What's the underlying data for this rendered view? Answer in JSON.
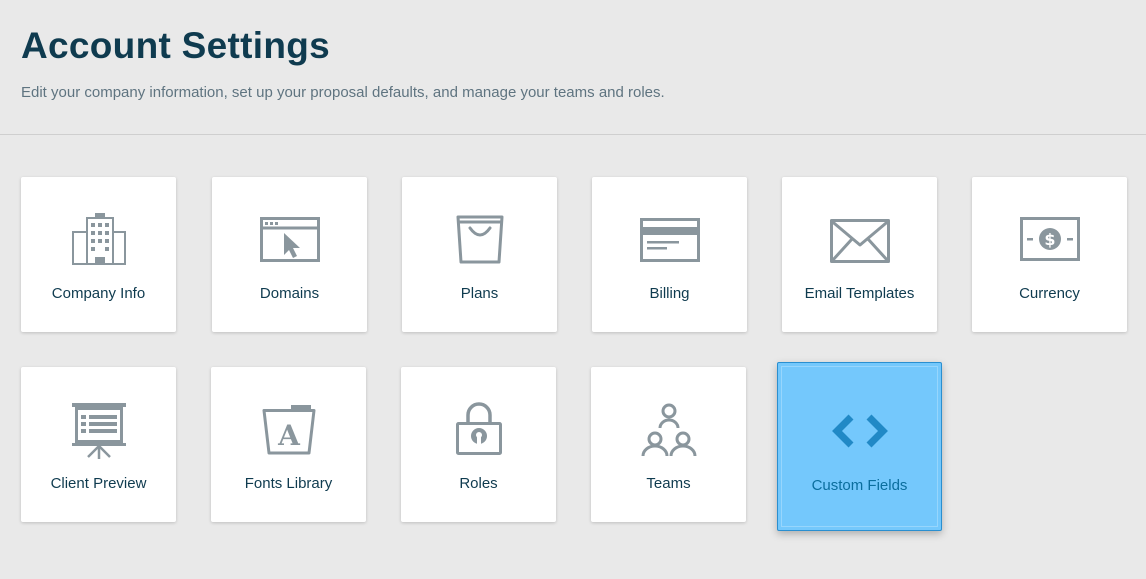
{
  "page": {
    "title": "Account Settings",
    "subtitle": "Edit your company information, set up your proposal defaults, and manage your teams and roles."
  },
  "colors": {
    "icon": "#8a969d",
    "selected_background": "#74c8fc",
    "selected_icon": "#2189c6",
    "title": "#0f3b4f"
  },
  "tiles": [
    {
      "label": "Company Info",
      "icon": "building-icon"
    },
    {
      "label": "Domains",
      "icon": "browser-cursor-icon"
    },
    {
      "label": "Plans",
      "icon": "shopping-bag-icon"
    },
    {
      "label": "Billing",
      "icon": "credit-card-icon"
    },
    {
      "label": "Email Templates",
      "icon": "envelope-icon"
    },
    {
      "label": "Currency",
      "icon": "banknote-icon"
    },
    {
      "label": "Client Preview",
      "icon": "presentation-board-icon"
    },
    {
      "label": "Fonts Library",
      "icon": "font-folder-icon"
    },
    {
      "label": "Roles",
      "icon": "padlock-icon"
    },
    {
      "label": "Teams",
      "icon": "team-icon"
    },
    {
      "label": "Custom Fields",
      "icon": "code-brackets-icon",
      "selected": true
    }
  ]
}
